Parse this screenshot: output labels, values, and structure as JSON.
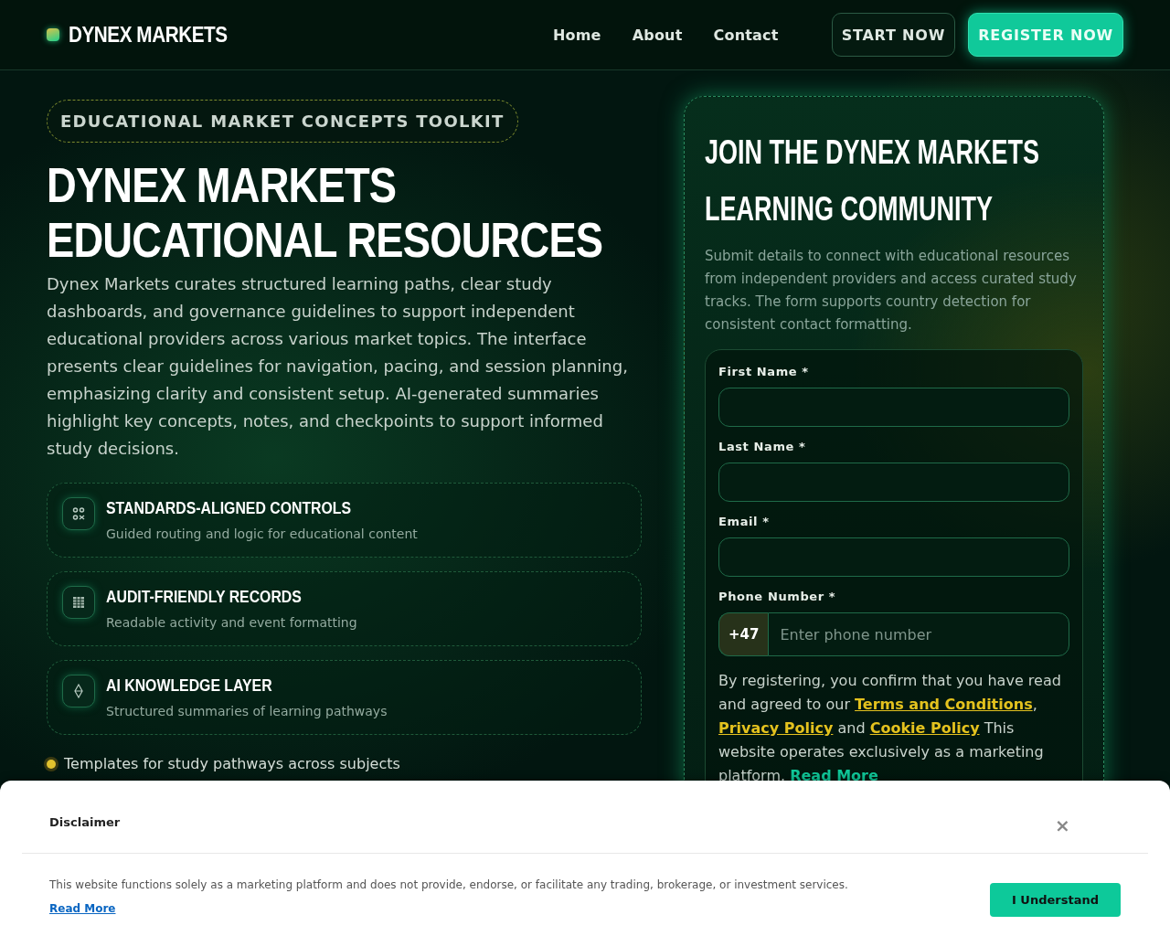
{
  "header": {
    "brand": "DYNEX MARKETS",
    "nav": [
      {
        "label": "Home"
      },
      {
        "label": "About"
      },
      {
        "label": "Contact"
      }
    ],
    "buttons": [
      {
        "label": "START NOW",
        "kind": "outline"
      },
      {
        "label": "REGISTER NOW",
        "kind": "filled"
      }
    ]
  },
  "hero": {
    "badge": "EDUCATIONAL MARKET CONCEPTS TOOLKIT",
    "title": "DYNEX MARKETS EDUCATIONAL RESOURCES",
    "description": "Dynex Markets curates structured learning paths, clear study dashboards, and governance guidelines to support independent educational providers across various market topics. The interface presents clear guidelines for navigation, pacing, and session planning, emphasizing clarity and consistent setup. AI-generated summaries highlight key concepts, notes, and checkpoints to support informed study decisions.",
    "features": [
      {
        "kind": "controls",
        "title": "STANDARDS-ALIGNED CONTROLS",
        "subtitle": "Guided routing and logic for educational content"
      },
      {
        "kind": "grid",
        "title": "AUDIT-FRIENDLY RECORDS",
        "subtitle": "Readable activity and event formatting"
      },
      {
        "kind": "diamond",
        "title": "AI KNOWLEDGE LAYER",
        "subtitle": "Structured summaries of learning pathways"
      }
    ],
    "bullets": [
      "Templates for study pathways across subjects"
    ]
  },
  "form": {
    "title": "JOIN THE DYNEX MARKETS LEARNING COMMUNITY",
    "intro": "Submit details to connect with educational resources from independent providers and access curated study tracks. The form supports country detection for consistent contact formatting.",
    "fields": [
      {
        "kind": "text",
        "label": "First Name *"
      },
      {
        "kind": "text",
        "label": "Last Name *"
      },
      {
        "kind": "email",
        "label": "Email *"
      },
      {
        "kind": "phone",
        "label": "Phone Number *",
        "prefix": "+47",
        "placeholder": "Enter phone number"
      }
    ],
    "consent": [
      {
        "kind": "text",
        "text": "By registering, you confirm that you have read and agreed to our "
      },
      {
        "kind": "legal-link",
        "text": "Terms and Conditions"
      },
      {
        "kind": "text",
        "text": ", "
      },
      {
        "kind": "legal-link",
        "text": "Privacy Policy"
      },
      {
        "kind": "text",
        "text": " and "
      },
      {
        "kind": "legal-link",
        "text": "Cookie Policy"
      },
      {
        "kind": "text",
        "text": " This website operates exclusively as a marketing platform. "
      },
      {
        "kind": "more-link",
        "text": "Read More"
      }
    ]
  },
  "disclaimer": {
    "title": "Disclaimer",
    "close": "×",
    "text": "This website functions solely as a marketing platform and does not provide, endorse, or facilitate any trading, brokerage, or investment services.",
    "link": "Read More",
    "button": "I Understand"
  }
}
